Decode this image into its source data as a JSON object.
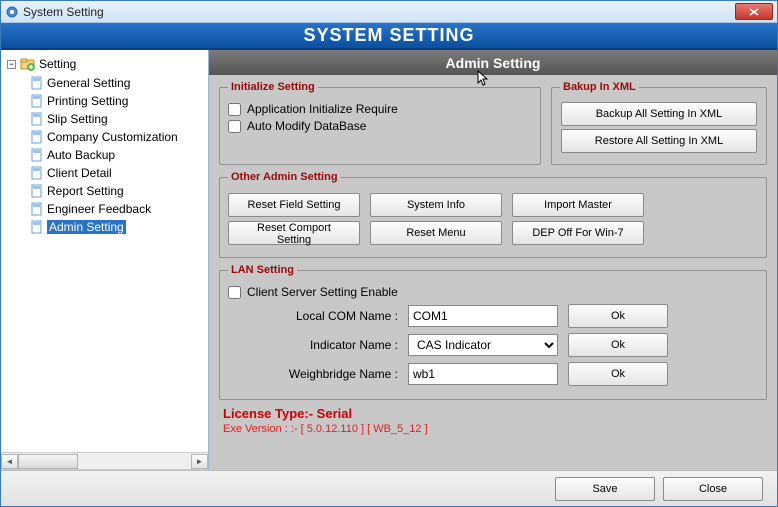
{
  "window": {
    "title": "System Setting"
  },
  "bluebar": {
    "title": "SYSTEM SETTING"
  },
  "tree": {
    "root": "Setting",
    "items": [
      {
        "label": "General Setting"
      },
      {
        "label": "Printing Setting"
      },
      {
        "label": "Slip Setting"
      },
      {
        "label": "Company Customization"
      },
      {
        "label": "Auto Backup"
      },
      {
        "label": "Client Detail"
      },
      {
        "label": "Report Setting"
      },
      {
        "label": "Engineer Feedback"
      },
      {
        "label": "Admin Setting"
      }
    ]
  },
  "panel": {
    "header": "Admin Setting"
  },
  "init": {
    "legend": "Initialize Setting",
    "chk1": "Application Initialize Require",
    "chk2": "Auto Modify DataBase"
  },
  "bak": {
    "legend": "Bakup In XML",
    "b1": "Backup All Setting In XML",
    "b2": "Restore All Setting In XML"
  },
  "other": {
    "legend": "Other Admin Setting",
    "b1": "Reset Field Setting",
    "b2": "System Info",
    "b3": "Import Master",
    "b4": "Reset Comport Setting",
    "b5": "Reset Menu",
    "b6": "DEP Off For Win-7"
  },
  "lan": {
    "legend": "LAN Setting",
    "chk": "Client Server Setting Enable",
    "l1": "Local COM Name :",
    "v1": "COM1",
    "l2": "Indicator Name :",
    "v2": "CAS Indicator",
    "l3": "Weighbridge Name :",
    "v3": "wb1",
    "ok": "Ok"
  },
  "license": {
    "line1": "License Type:- Serial",
    "line2": "Exe Version : :-  [ 5.0.12.110 ] [ WB_5_12 ]"
  },
  "footer": {
    "save": "Save",
    "close": "Close"
  }
}
